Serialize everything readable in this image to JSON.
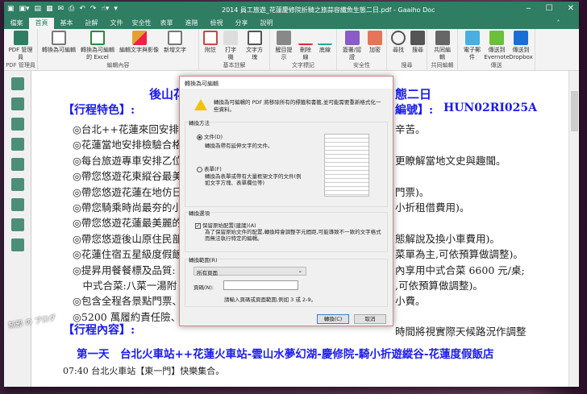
{
  "window": {
    "title": "2014 員工旅遊_花蓮慶修院折騎之旅蒜容纖魚生態二日.pdf - Gaaiho Doc",
    "minimize": "‒",
    "maximize": "☐",
    "close": "✕",
    "collapse": "˄"
  },
  "quick_access": [
    "▣",
    "▣▾",
    "▤",
    "▦",
    "✉",
    "⎙",
    "↶",
    "↷",
    "☝▾",
    "▾"
  ],
  "tabs": [
    "檔案",
    "首頁",
    "基本",
    "註解",
    "文件",
    "安全性",
    "表單",
    "進階",
    "檢視",
    "分享",
    "說明"
  ],
  "ribbon": {
    "groups": [
      {
        "label": "PDF 管理員",
        "buttons": [
          "PDF 管理員"
        ]
      },
      {
        "label": "編輯內容",
        "buttons": [
          "轉換為可編輯",
          "轉換為可編輯的 Excel",
          "編輯文字與影像",
          "新增文字"
        ]
      },
      {
        "label": "基本註解",
        "buttons": [
          "附註",
          "打字機",
          "文字方塊"
        ]
      },
      {
        "label": "文字標記",
        "buttons": [
          "醒目提示",
          "刪除線",
          "底線"
        ]
      },
      {
        "label": "安全性",
        "buttons": [
          "簽署/認證",
          "加密"
        ]
      },
      {
        "label": "搜尋",
        "buttons": [
          "尋找",
          "搜尋"
        ]
      },
      {
        "label": "共同編輯",
        "buttons": [
          "共同編輯"
        ]
      },
      {
        "label": "傳送",
        "buttons": [
          "電子郵件",
          "傳送到 Evernote",
          "傳送到 Dropbox"
        ]
      }
    ]
  },
  "document": {
    "title_left": "後山花",
    "title_right": "態二日",
    "feature_heading": "【行程特色】:",
    "code_label": "編號】:",
    "code": "HUN02RI025A",
    "lines": [
      {
        "l": "◎台北++花蓮來回安排搭",
        "r": "辛苦。"
      },
      {
        "l": "◎花蓮當地安排檢驗合格",
        "r": ""
      },
      {
        "l": "◎每台旅遊專車安排乙位",
        "r": "更瞭解當地文史與趣聞。"
      },
      {
        "l": "◎帶您悠遊花東縱谷最美",
        "r": ""
      },
      {
        "l": "◎帶您悠遊花蓮在地仿日",
        "r": "門票)。"
      },
      {
        "l": "◎帶您騎乘時尚最夯的小",
        "r": "小折租借費用)。"
      },
      {
        "l": "◎帶您悠遊花蓮最美麗的",
        "r": ""
      },
      {
        "l": "◎帶您悠遊後山原住民部",
        "r": "態解說及換小車費用)。"
      },
      {
        "l": "◎花蓮住宿五星級度假飯",
        "r": "菜單為主,可依預算做調整)。"
      },
      {
        "l": "◎提昇用餐餐標及品質:",
        "r": "內享用中式合菜 6600 元/桌;"
      },
      {
        "l": "　中式合菜:八菜一湯附",
        "r": ",可依預算做調整)。"
      },
      {
        "l": "◎包含全程各景點門票、",
        "r": "小費。"
      },
      {
        "l": "◎5200 萬履約責任險、2",
        "r": ""
      }
    ],
    "itinerary_heading": "【行程內容】:",
    "itinerary_note": "時間將視實際天候路況作調整",
    "day1": "第一天　台北火車站++花蓮火車站-雲山水夢幻湖-慶修院-騎小折遊縱谷-花蓮度假飯店",
    "day1_first": "07:40 台北火車站【東一門】快樂集合。"
  },
  "dialog": {
    "title": "轉換為可編輯",
    "warning": "轉換為可編輯的 PDF 將移除所有的標籤和書籤,並可能需要重新格式化一些資料。",
    "method_label": "轉換方法",
    "opt_doc": "文件(D)",
    "opt_doc_desc": "轉換為帶有延伸文字的文件。",
    "opt_form": "表單(F)",
    "opt_form_desc": "轉換為表單或帶有大量框架文字的文件(例如文字方塊、表單欄位等)",
    "options_label": "轉換選項",
    "keep_layout": "保留原始配置(建議)(A)",
    "keep_layout_desc": "為了保留原始文件的配置,轉換時會調整字元間距,可能導致不一致的文字格式而無法執行特定的編輯。",
    "range_label": "轉換範圍(R)",
    "range_value": "所有頁面",
    "pages_label": "頁碼(N):",
    "pages_value": "",
    "pages_hint": "請輸入頁碼或頁面範圍,例如 3 或 2-9。",
    "convert": "轉換(C)",
    "cancel": "取消"
  },
  "watermark": "無邪 の ブログ"
}
